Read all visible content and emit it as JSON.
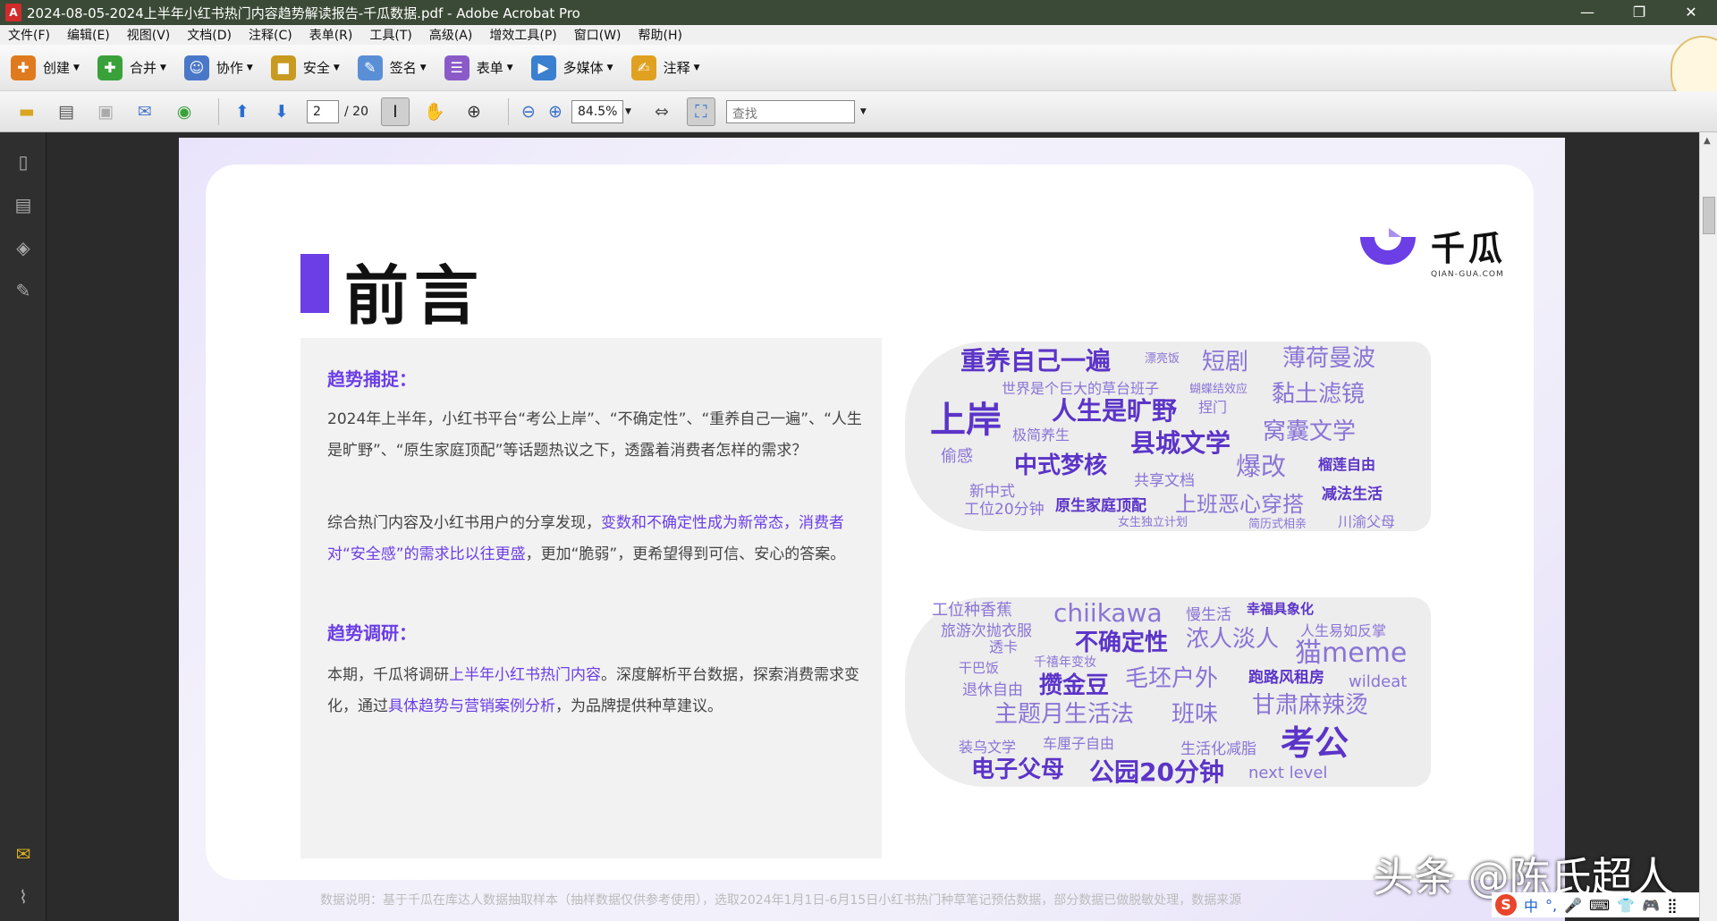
{
  "window": {
    "title": "2024-08-05-2024上半年小红书热门内容趋势解读报告-千瓜数据.pdf - Adobe Acrobat Pro",
    "min": "—",
    "max": "❐",
    "close": "✕"
  },
  "menu": [
    "文件(F)",
    "编辑(E)",
    "视图(V)",
    "文档(D)",
    "注释(C)",
    "表单(R)",
    "工具(T)",
    "高级(A)",
    "增效工具(P)",
    "窗口(W)",
    "帮助(H)"
  ],
  "toolbar1": [
    {
      "label": "创建",
      "icon": "create-pdf-icon",
      "color": "#e07a1e",
      "glyph": "✚"
    },
    {
      "label": "合并",
      "icon": "combine-icon",
      "color": "#3aa13a",
      "glyph": "✚"
    },
    {
      "label": "协作",
      "icon": "collaborate-icon",
      "color": "#4a78c8",
      "glyph": "☺"
    },
    {
      "label": "安全",
      "icon": "lock-icon",
      "color": "#c89a20",
      "glyph": "🔒"
    },
    {
      "label": "签名",
      "icon": "pen-icon",
      "color": "#5a8fd6",
      "glyph": "✎"
    },
    {
      "label": "表单",
      "icon": "form-icon",
      "color": "#8a5ac8",
      "glyph": "☰"
    },
    {
      "label": "多媒体",
      "icon": "multimedia-icon",
      "color": "#3a7fd0",
      "glyph": "▶"
    },
    {
      "label": "注释",
      "icon": "comment-icon",
      "color": "#e0a020",
      "glyph": "✍"
    }
  ],
  "toolbar2": {
    "page_current": "2",
    "page_total": "/ 20",
    "zoom": "84.5%",
    "find_placeholder": "查找"
  },
  "doc": {
    "heading": "前言",
    "logo_cn": "千瓜",
    "logo_en": "QIAN-GUA.COM",
    "sec1_title": "趋势捕捉：",
    "p1": "2024年上半年，小红书平台“考公上岸”、“不确定性”、“重养自己一遍”、“人生是旷野”、“原生家庭顶配”等话题热议之下，透露着消费者怎样的需求？",
    "p2a": "综合热门内容及小红书用户的分享发现，",
    "p2b": "变数和不确定性成为新常态，消费者对“安全感”的需求比以往更盛",
    "p2c": "，更加“脆弱”，更希望得到可信、安心的答案。",
    "sec2_title": "趋势调研：",
    "p3a": "本期，千瓜将调研",
    "p3b": "上半年小红书热门内容",
    "p3c": "。深度解析平台数据，探索消费需求变化，通过",
    "p3d": "具体趋势与营销案例分析",
    "p3e": "，为品牌提供种草建议。",
    "footnote": "数据说明：基于千瓜在库达人数据抽取样本（抽样数据仅供参考使用），选取2024年1月1日-6月15日小红书热门种草笔记预估数据，部分数据已做脱敏处理，数据来源"
  },
  "cloud1": [
    "重养自己一遍",
    "漂亮饭",
    "短剧",
    "薄荷曼波",
    "世界是个巨大的草台班子",
    "蝴蝶结效应",
    "上岸",
    "人生是旷野",
    "捏门",
    "黏土滤镜",
    "极简养生",
    "窝囊文学",
    "县城文学",
    "偷感",
    "中式梦核",
    "爆改",
    "榴莲自由",
    "新中式",
    "共享文档",
    "减法生活",
    "工位20分钟",
    "原生家庭顶配",
    "上班恶心穿搭",
    "女生独立计划",
    "简历式相亲",
    "川渝父母"
  ],
  "cloud2": [
    "工位种香蕉",
    "chiikawa",
    "慢生活",
    "幸福具象化",
    "旅游次抛衣服",
    "不确定性",
    "浓人淡人",
    "人生易如反掌",
    "透卡",
    "猫meme",
    "干巴饭",
    "千禧年变妆",
    "毛坯户外",
    "跑路风租房",
    "退休自由",
    "攒金豆",
    "wildeat",
    "主题月生活法",
    "班味",
    "甘肃麻辣烫",
    "装乌文学",
    "车厘子自由",
    "生活化减脂",
    "考公",
    "电子父母",
    "公园20分钟",
    "next level"
  ],
  "watermark": "头条 @陈氏超人",
  "ime": [
    "S",
    "中",
    "°,",
    "🎤",
    "⌨",
    "👕",
    "🎮",
    "⣿"
  ]
}
